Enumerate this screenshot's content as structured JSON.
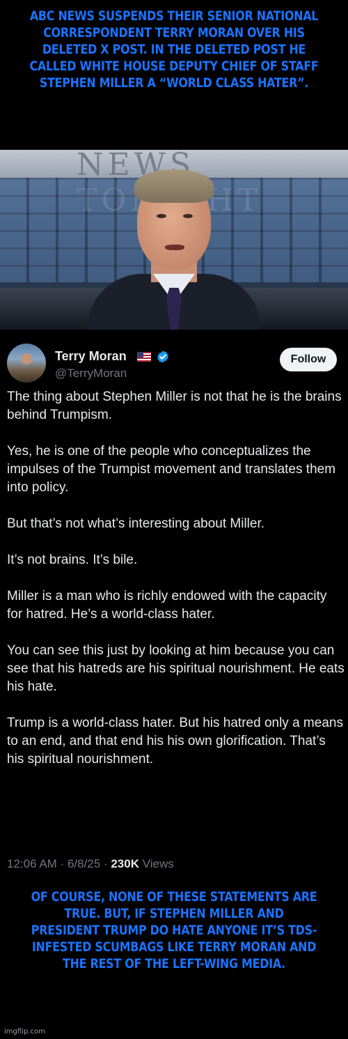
{
  "captions": {
    "top": "ABC NEWS SUSPENDS THEIR SENIOR NATIONAL CORRESPONDENT TERRY MORAN OVER HIS DELETED X POST. IN THE DELETED POST HE CALLED WHITE HOUSE DEPUTY CHIEF OF STAFF STEPHEN MILLER A “WORLD CLASS HATER”.",
    "bottom": "OF COURSE, NONE OF THESE STATEMENTS ARE TRUE. BUT, IF STEPHEN MILLER AND PRESIDENT TRUMP DO HATE ANYONE IT’S TDS-INFESTED SCUMBAGS LIKE TERRY MORAN AND THE REST OF THE LEFT-WING MEDIA.",
    "color": "#1a73ff"
  },
  "photo": {
    "banner_text": "NEWS TONIGHT"
  },
  "tweet": {
    "display_name": "Terry Moran",
    "flag_icon": "us-flag-icon",
    "verified_icon": "verified-badge-icon",
    "handle": "@TerryMoran",
    "follow_label": "Follow",
    "paragraphs": [
      "The thing about Stephen Miller is not that he is the brains behind Trumpism.",
      "Yes, he is one of the people who conceptualizes the impulses of the Trumpist movement and translates them into policy.",
      "But that’s not what’s interesting about Miller.",
      "It’s not brains. It’s bile.",
      "Miller is a man who is richly endowed with the capacity for hatred. He’s a world-class hater.",
      "You can see this just by looking at him because you can see that his hatreds are his spiritual nourishment. He eats his hate.",
      "Trump is a world-class hater. But his hatred only a means to an end, and that end his his own glorification. That’s his spiritual nourishment."
    ],
    "time": "12:06 AM",
    "date": "6/8/25",
    "views_count": "230K",
    "views_label": "Views",
    "accent_color": "#1d9bf0"
  },
  "watermark": "imgflip.com"
}
